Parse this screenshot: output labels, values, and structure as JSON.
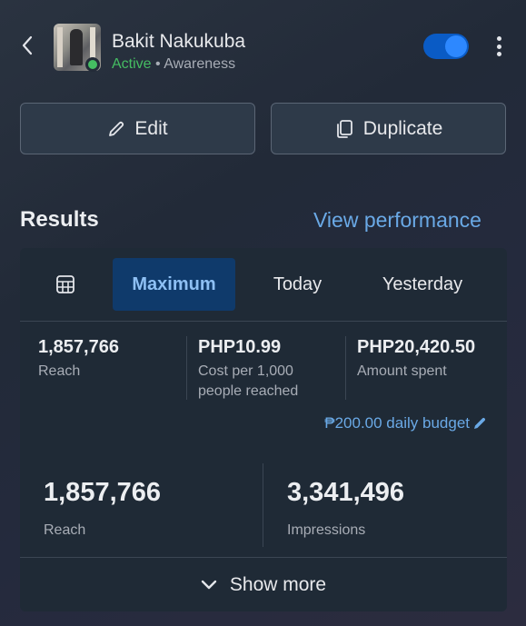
{
  "header": {
    "name": "Bakit Nakukuba",
    "status": "Active",
    "separator": "•",
    "objective": "Awareness",
    "toggle_on": true
  },
  "actions": {
    "edit_label": "Edit",
    "duplicate_label": "Duplicate"
  },
  "results": {
    "title": "Results",
    "view_performance": "View performance"
  },
  "tabs": {
    "maximum": "Maximum",
    "today": "Today",
    "yesterday": "Yesterday",
    "selected": "Maximum"
  },
  "metrics": {
    "reach_value": "1,857,766",
    "reach_label": "Reach",
    "cpm_value": "PHP10.99",
    "cpm_label_1": "Cost per 1,000",
    "cpm_label_2": "people reached",
    "spent_value": "PHP20,420.50",
    "spent_label": "Amount spent",
    "budget": "₱200.00 daily budget"
  },
  "summary": {
    "reach_value": "1,857,766",
    "reach_label": "Reach",
    "impressions_value": "3,341,496",
    "impressions_label": "Impressions"
  },
  "footer": {
    "show_more": "Show more"
  },
  "colors": {
    "accent": "#6aa9e6",
    "active": "#45bd62",
    "selected_tab_bg": "#0f3a6b",
    "card_bg": "#1f2a36"
  }
}
